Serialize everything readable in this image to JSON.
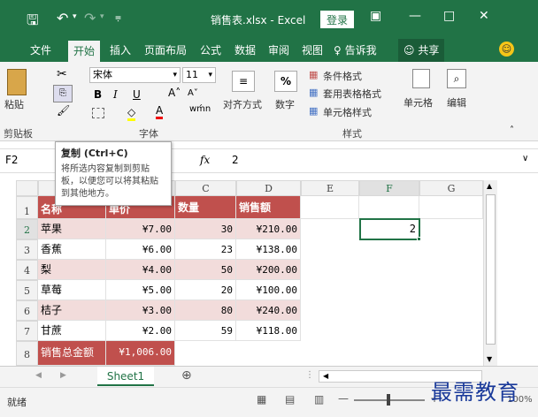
{
  "titlebar": {
    "title": "销售表.xlsx - Excel",
    "login": "登录",
    "icons": [
      "save-icon",
      "undo-icon",
      "redo-icon",
      "customize-icon"
    ]
  },
  "menu": {
    "tabs": [
      "文件",
      "开始",
      "插入",
      "页面布局",
      "公式",
      "数据",
      "审阅",
      "视图"
    ],
    "tell_me": "告诉我",
    "share": "共享"
  },
  "ribbon": {
    "paste": "粘贴",
    "clipboard_group": "剪贴板",
    "font_name": "宋体",
    "font_size": "11",
    "font_group": "字体",
    "bold": "B",
    "italic": "I",
    "underline": "U",
    "align_label": "对齐方式",
    "number_label": "数字",
    "percent": "%",
    "cond_format": "条件格式",
    "table_format": "套用表格格式",
    "cell_style": "单元格样式",
    "styles_group": "样式",
    "cells_label": "单元格",
    "edit_label": "编辑"
  },
  "tooltip": {
    "title": "复制 (Ctrl+C)",
    "body": "将所选内容复制到剪贴板，以便您可以将其粘贴到其他地方。"
  },
  "formula_bar": {
    "name_box": "F2",
    "fx": "fx",
    "value": "2"
  },
  "columns": [
    "C",
    "D",
    "E",
    "F",
    "G"
  ],
  "rows": [
    "1",
    "2",
    "3",
    "4",
    "5",
    "6",
    "7",
    "8"
  ],
  "header_row": {
    "col_a": "名称",
    "col_b": "单价",
    "col_c": "数量",
    "col_d": "销售额"
  },
  "data_rows": [
    {
      "name": "苹果",
      "price": "¥7.00",
      "qty": "30",
      "sales": "¥210.00"
    },
    {
      "name": "香蕉",
      "price": "¥6.00",
      "qty": "23",
      "sales": "¥138.00"
    },
    {
      "name": "梨",
      "price": "¥4.00",
      "qty": "50",
      "sales": "¥200.00"
    },
    {
      "name": "草莓",
      "price": "¥5.00",
      "qty": "20",
      "sales": "¥100.00"
    },
    {
      "name": "桔子",
      "price": "¥3.00",
      "qty": "80",
      "sales": "¥240.00"
    },
    {
      "name": "甘蔗",
      "price": "¥2.00",
      "qty": "59",
      "sales": "¥118.00"
    }
  ],
  "total_row": {
    "label": "销售总金额",
    "value": "¥1,006.00"
  },
  "f2_value": "2",
  "sheet_tab": "Sheet1",
  "status": "就绪",
  "zoom_label": "100%",
  "watermark": "最需教育",
  "colors": {
    "excel_green": "#217346",
    "header_red": "#c0504d",
    "band_pink": "#f2dcdb"
  }
}
